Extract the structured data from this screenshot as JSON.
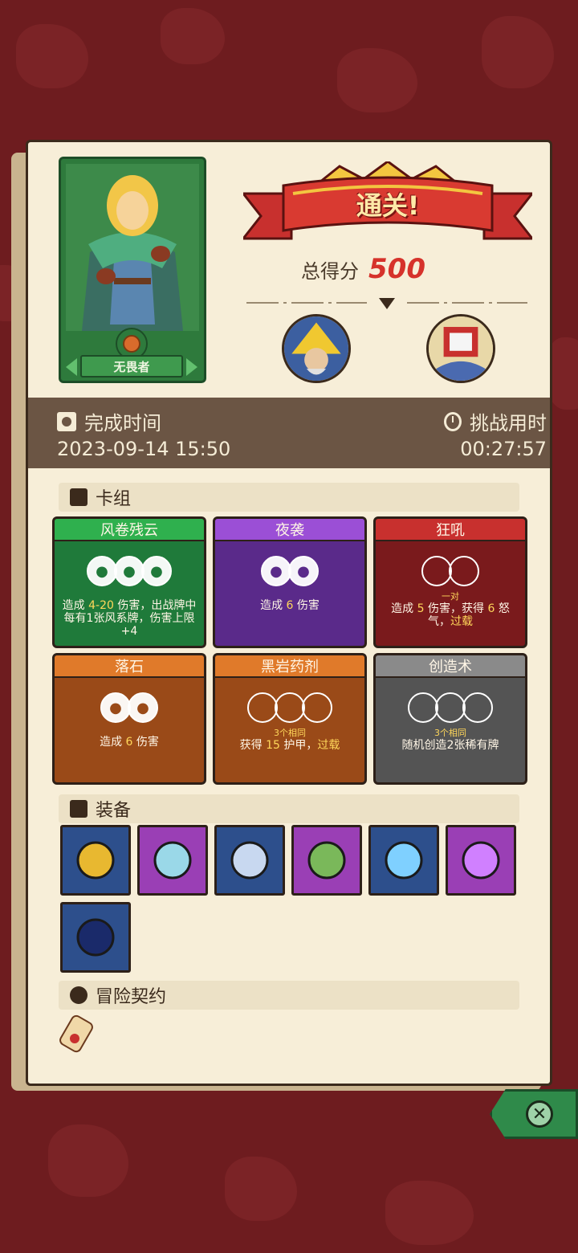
{
  "hero": {
    "name": "无畏者"
  },
  "result": {
    "banner": "通关!",
    "score_label": "总得分",
    "score_value": "500"
  },
  "times": {
    "finish_label": "完成时间",
    "finish_value": "2023-09-14 15:50",
    "challenge_label": "挑战用时",
    "challenge_value": "00:27:57"
  },
  "sections": {
    "deck": "卡组",
    "equipment": "装备",
    "contract": "冒险契约"
  },
  "cards": [
    {
      "title": "风卷残云",
      "color": "#1f7a3a",
      "header": "#2fb04e",
      "slot_count": 3,
      "filled": true,
      "sub": "",
      "desc_a": "造成 ",
      "desc_hl": "4-20",
      "desc_b": " 伤害，出战牌中每有1张风系牌，伤害上限+4"
    },
    {
      "title": "夜袭",
      "color": "#5a2a8a",
      "header": "#9b4fd6",
      "slot_count": 2,
      "filled": true,
      "sub": "",
      "desc_a": "造成 ",
      "desc_hl": "6",
      "desc_b": " 伤害"
    },
    {
      "title": "狂吼",
      "color": "#7a1a1c",
      "header": "#c8302e",
      "slot_count": 2,
      "filled": false,
      "sub": "一对",
      "desc_a": "造成 ",
      "desc_hl": "5",
      "desc_b": " 伤害，获得 ",
      "desc_hl2": "6",
      "desc_c": " 怒气，",
      "desc_hl3": "过载"
    },
    {
      "title": "落石",
      "color": "#9a4a18",
      "header": "#e07a2a",
      "slot_count": 2,
      "filled": true,
      "sub": "",
      "desc_a": "造成 ",
      "desc_hl": "6",
      "desc_b": " 伤害"
    },
    {
      "title": "黑岩药剂",
      "color": "#9a4a18",
      "header": "#e07a2a",
      "slot_count": 3,
      "filled": false,
      "sub": "3个相同",
      "desc_a": "获得 ",
      "desc_hl": "15",
      "desc_b": " 护甲，",
      "desc_hl3": "过载"
    },
    {
      "title": "创造术",
      "color": "#545454",
      "header": "#8a8a8a",
      "slot_count": 3,
      "filled": false,
      "sub": "3个相同",
      "desc_a": "随机创造2张稀有牌",
      "desc_hl": "",
      "desc_b": ""
    }
  ],
  "equipment": [
    {
      "name": "ring-icon",
      "bg": "blue"
    },
    {
      "name": "dagger-icon",
      "bg": "purple"
    },
    {
      "name": "compass-icon",
      "bg": "blue"
    },
    {
      "name": "leaf-ring-icon",
      "bg": "purple"
    },
    {
      "name": "crystal-icon",
      "bg": "blue"
    },
    {
      "name": "potion-icon",
      "bg": "purple"
    },
    {
      "name": "wizard-hat-icon",
      "bg": "blue"
    }
  ],
  "colors": {
    "score": "#d6322b",
    "highlight": "#ffd75a"
  }
}
